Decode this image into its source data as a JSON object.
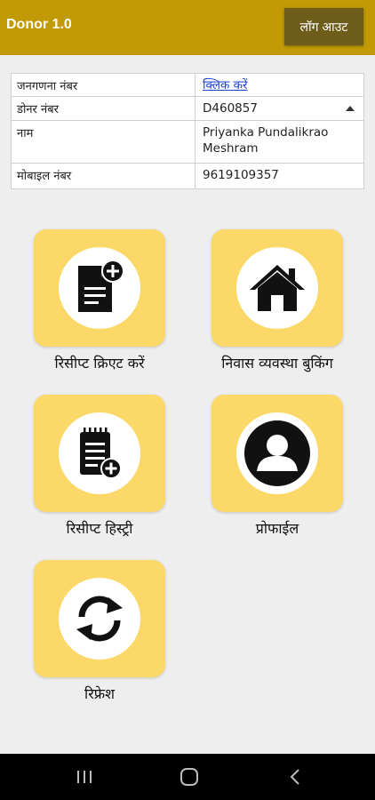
{
  "appbar": {
    "title": "Donor 1.0",
    "logout_label": "लॉग आउट"
  },
  "info": {
    "census_label": "जनगणना नंबर",
    "census_value": "क्लिक करें",
    "donor_label": "डोनर नंबर",
    "donor_value": "D460857",
    "name_label": "नाम",
    "name_value": "Priyanka Pundalikrao Meshram",
    "mobile_label": "मोबाइल नंबर",
    "mobile_value": "9619109357"
  },
  "tiles": [
    {
      "label": "रिसीप्ट क्रिएट करें",
      "icon": "document-add-icon"
    },
    {
      "label": "निवास व्यवस्था बुकिंग",
      "icon": "home-icon"
    },
    {
      "label": "रिसीप्ट हिस्ट्री",
      "icon": "notepad-add-icon"
    },
    {
      "label": "प्रोफाईल",
      "icon": "user-icon"
    },
    {
      "label": "रिफ्रेश",
      "icon": "refresh-icon"
    }
  ],
  "colors": {
    "appbar": "#c19a06",
    "logout_button": "#6e5c1a",
    "tile": "#fbd867",
    "link": "#1a3fd6"
  }
}
